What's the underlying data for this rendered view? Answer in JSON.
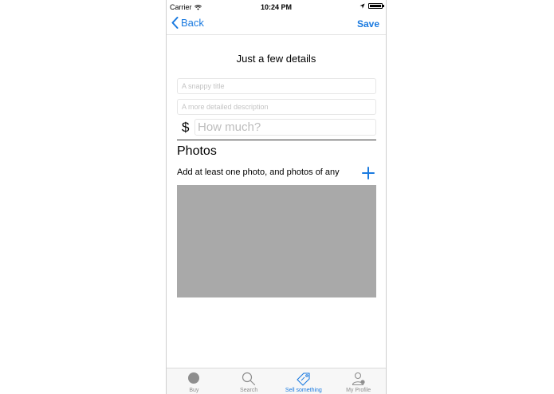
{
  "status": {
    "carrier": "Carrier",
    "time": "10:24 PM"
  },
  "nav": {
    "back_label": "Back",
    "save_label": "Save"
  },
  "form": {
    "heading": "Just a few details",
    "title_placeholder": "A snappy title",
    "description_placeholder": "A more detailed description",
    "currency_symbol": "$",
    "price_placeholder": "How much?"
  },
  "photos": {
    "heading": "Photos",
    "hint": "Add at least one photo, and photos of any"
  },
  "tabs": [
    {
      "label": "Buy",
      "icon": "circle-icon"
    },
    {
      "label": "Search",
      "icon": "search-icon"
    },
    {
      "label": "Sell something",
      "icon": "tag-icon",
      "active": true
    },
    {
      "label": "My Profile",
      "icon": "profile-icon"
    }
  ],
  "colors": {
    "accent": "#1a7ae0",
    "photo_placeholder": "#a9a9a9",
    "tab_inactive": "#8e8e8e"
  }
}
